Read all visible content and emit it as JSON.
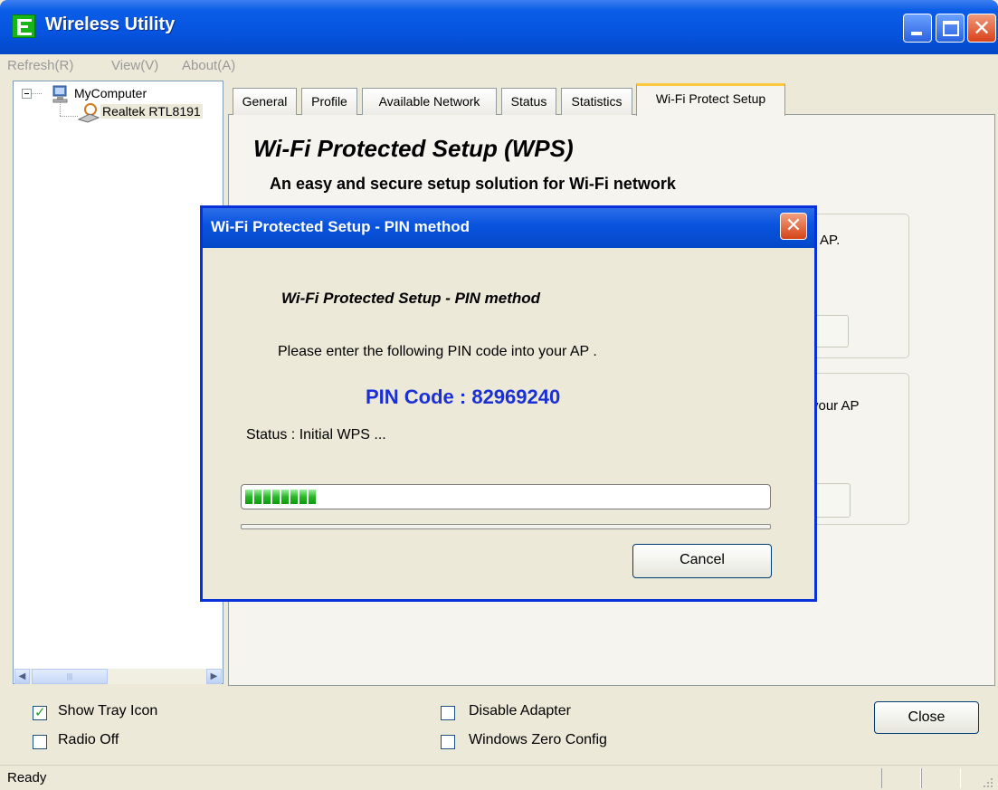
{
  "window": {
    "title": "Wireless Utility"
  },
  "menu": [
    "Refresh(R)",
    "View(V)",
    "About(A)"
  ],
  "tree": {
    "root": "MyComputer",
    "child": "Realtek RTL8191"
  },
  "tabs": [
    "General",
    "Profile",
    "Available Network",
    "Status",
    "Statistics",
    "Wi-Fi Protect Setup"
  ],
  "wps": {
    "heading": "Wi-Fi Protected Setup (WPS)",
    "subheading": "An easy and secure setup solution for Wi-Fi network",
    "group1_text": "AP.",
    "group2_text": "your AP"
  },
  "dialog": {
    "title": "Wi-Fi Protected Setup - PIN method",
    "heading": "Wi-Fi Protected Setup - PIN method",
    "instruction": "Please enter the following PIN code into your AP .",
    "pin_label": "PIN Code :  82969240",
    "status": "Status :  Initial WPS ...",
    "progress_blocks": 8,
    "cancel_label": "Cancel"
  },
  "options": {
    "show_tray_icon": {
      "label": "Show Tray Icon",
      "checked": true
    },
    "radio_off": {
      "label": "Radio Off",
      "checked": false
    },
    "disable_adapter": {
      "label": "Disable Adapter",
      "checked": false
    },
    "windows_zero_config": {
      "label": "Windows Zero Config",
      "checked": false
    }
  },
  "close_label": "Close",
  "statusbar": {
    "text": "Ready"
  },
  "colors": {
    "titlebar": "#0654e0",
    "pin": "#1a2fd4",
    "progress": "#27b827",
    "dialog_border": "#0831d9"
  }
}
